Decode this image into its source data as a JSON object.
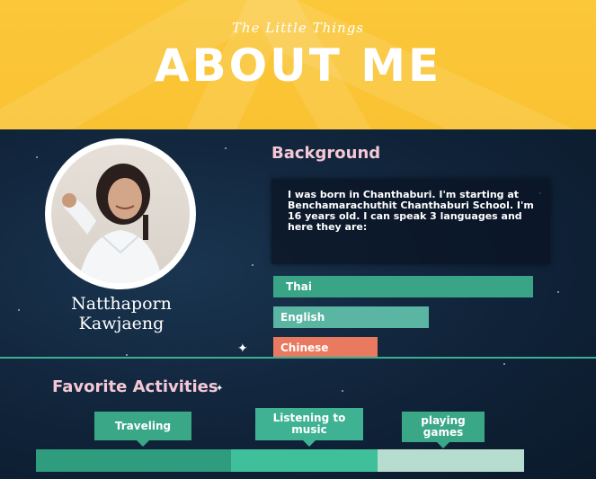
{
  "header": {
    "subtitle": "The Little Things",
    "title": "ABOUT ME"
  },
  "profile": {
    "name_line1": "Natthaporn",
    "name_line2": "Kawjaeng"
  },
  "background": {
    "heading": "Background",
    "text": "I was born in Chanthaburi. I'm starting at Benchamarachuthit Chanthaburi School. I'm 16 years old. I can speak 3 languages and here they are:"
  },
  "languages": [
    {
      "label": "Thai",
      "level": 1.0,
      "color": "#3aa486"
    },
    {
      "label": "English",
      "level": 0.6,
      "color": "#5ab5a3"
    },
    {
      "label": "Chinese",
      "level": 0.4,
      "color": "#e97a60"
    }
  ],
  "activities": {
    "heading": "Favorite Activities",
    "items": [
      {
        "label": "Traveling",
        "share": 0.4,
        "color": "#2f9c7e"
      },
      {
        "label": "Listening to music",
        "share": 0.3,
        "color": "#3fbf9a"
      },
      {
        "label": "playing games",
        "share": 0.3,
        "color": "#b7ddd0"
      }
    ]
  },
  "colors": {
    "header_yellow": "#fbc83a",
    "space_navy": "#102339",
    "heading_pink": "#f6c7d5",
    "accent_green": "#3aa787"
  }
}
